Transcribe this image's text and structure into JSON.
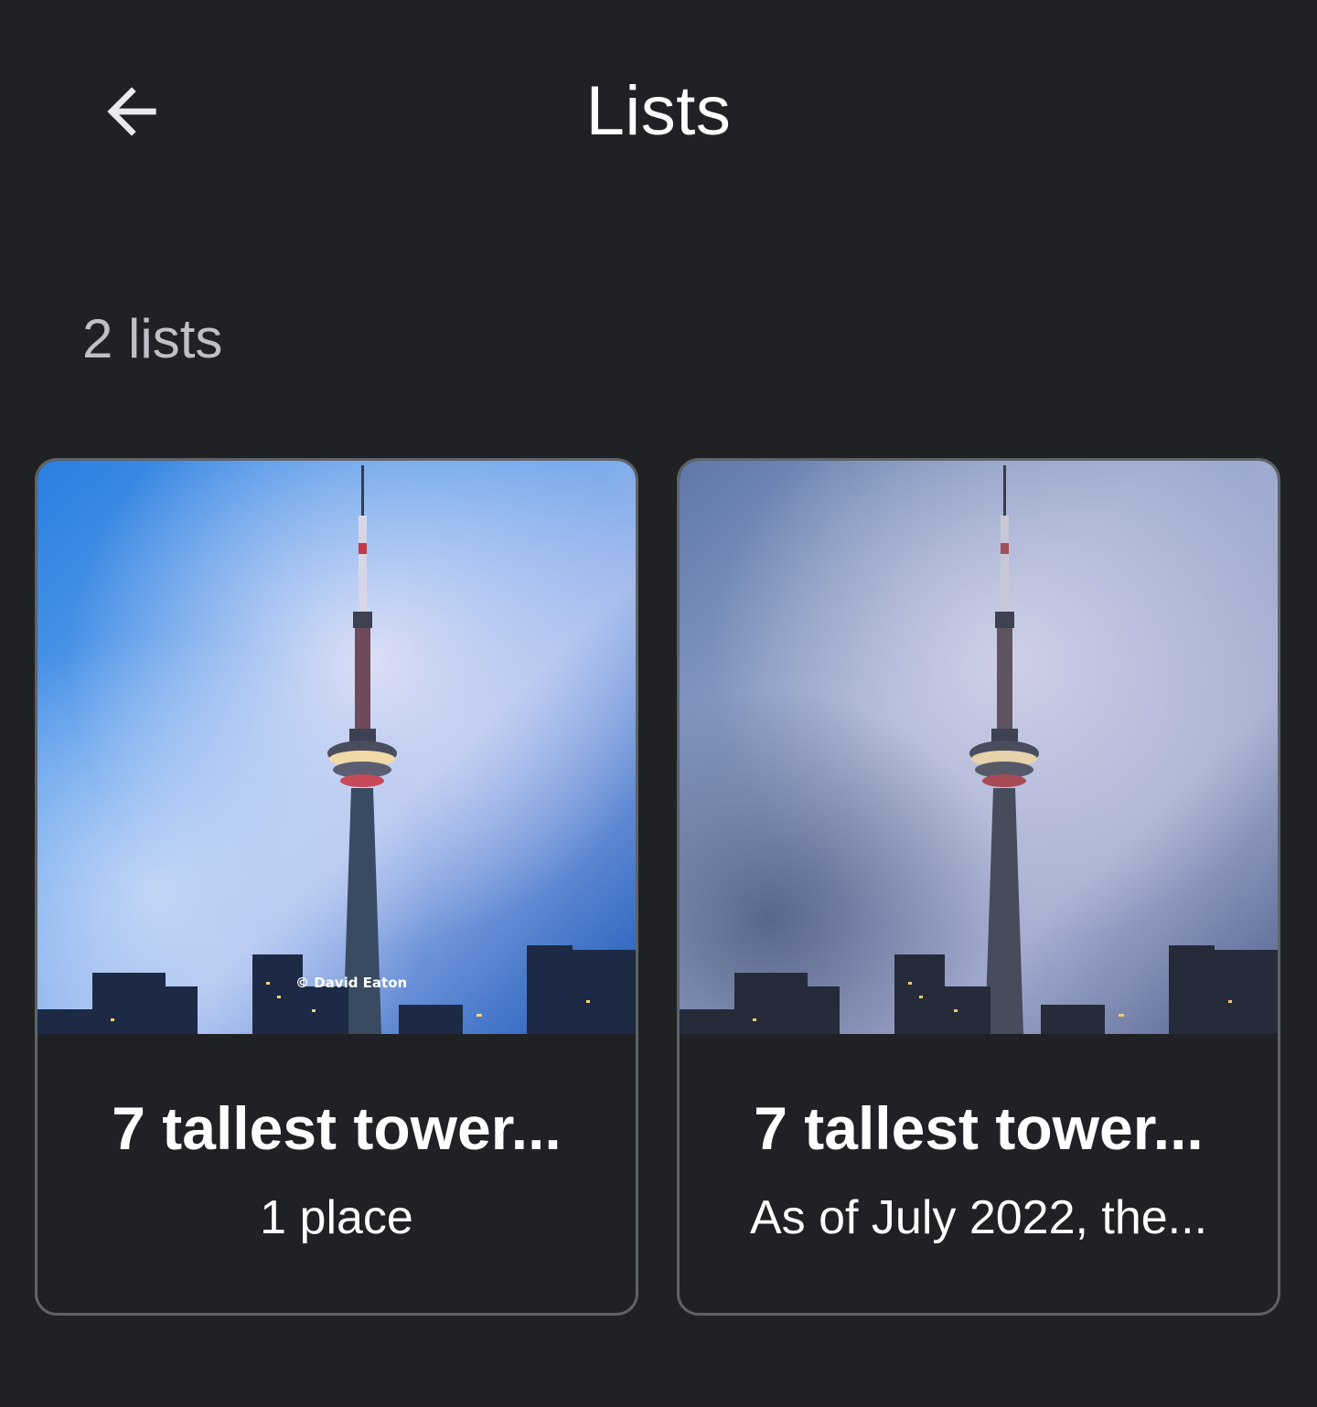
{
  "header": {
    "title": "Lists",
    "back_icon": "arrow-back-icon"
  },
  "list_count": "2 lists",
  "cards": [
    {
      "title": "7 tallest tower...",
      "subtitle": "1 place",
      "image_watermark": "© David Eaton",
      "image_subject": "CN Tower against a bright blue sky"
    },
    {
      "title": "7 tallest tower...",
      "subtitle": "As of July 2022, the...",
      "image_subject": "CN Tower against a cloudy dusk sky"
    }
  ],
  "colors": {
    "background": "#202124",
    "card_border": "#5f6368",
    "secondary_text": "#bdc1c6"
  }
}
